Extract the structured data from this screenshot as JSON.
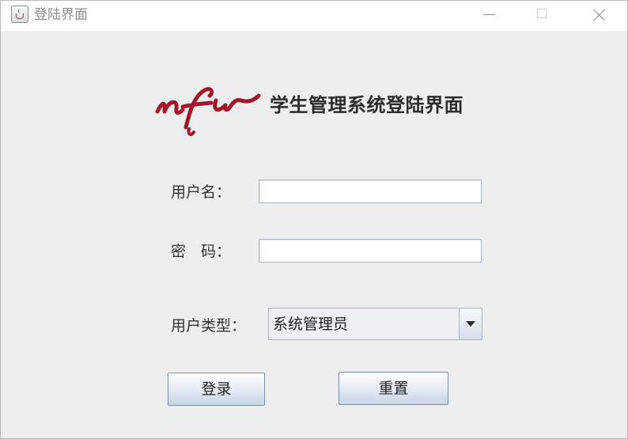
{
  "window": {
    "title": "登陆界面",
    "controls": {
      "minimize": "minimize-icon",
      "maximize": "maximize-icon",
      "close": "close-icon"
    }
  },
  "header": {
    "logo_text": "nfu",
    "logo_color": "#a3162a",
    "title": "学生管理系统登陆界面"
  },
  "form": {
    "username_label": "用户名：",
    "username_value": "",
    "password_label": "密　码：",
    "password_value": "",
    "user_type_label": "用户类型：",
    "user_type_selected": "系统管理员"
  },
  "buttons": {
    "login": "登录",
    "reset": "重置"
  }
}
